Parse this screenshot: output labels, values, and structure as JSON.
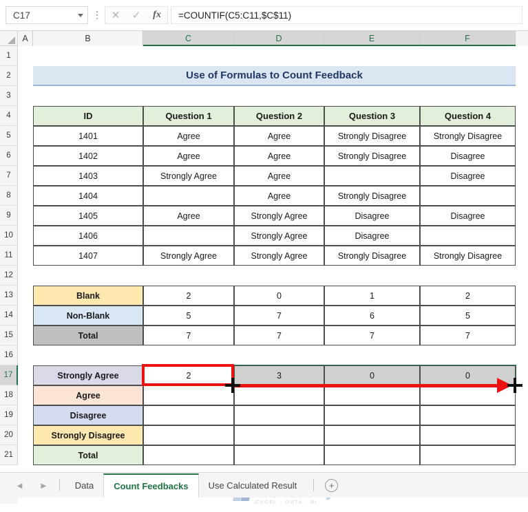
{
  "app": {
    "name_box_value": "C17",
    "formula_value": "=COUNTIF(C5:C11,$C$11)",
    "cancel_icon": "close-icon",
    "confirm_icon": "check-icon",
    "function_icon": "fx"
  },
  "columns": [
    {
      "label": "A",
      "selected": false
    },
    {
      "label": "B",
      "selected": false
    },
    {
      "label": "C",
      "selected": true
    },
    {
      "label": "D",
      "selected": true
    },
    {
      "label": "E",
      "selected": true
    },
    {
      "label": "F",
      "selected": true
    }
  ],
  "rows": [
    "1",
    "2",
    "3",
    "4",
    "5",
    "6",
    "7",
    "8",
    "9",
    "10",
    "11",
    "12",
    "13",
    "14",
    "15",
    "16",
    "17",
    "18",
    "19",
    "20",
    "21"
  ],
  "selected_row": "17",
  "title": "Use of Formulas to Count Feedback",
  "feedback_table": {
    "headers": [
      "ID",
      "Question 1",
      "Question 2",
      "Question 3",
      "Question 4"
    ],
    "rows": [
      [
        "1401",
        "Agree",
        "Agree",
        "Strongly Disagree",
        "Strongly Disagree"
      ],
      [
        "1402",
        "Agree",
        "Agree",
        "Strongly Disagree",
        "Disagree"
      ],
      [
        "1403",
        "Strongly Agree",
        "Agree",
        "",
        "Disagree"
      ],
      [
        "1404",
        "",
        "Agree",
        "Strongly Disagree",
        ""
      ],
      [
        "1405",
        "Agree",
        "Strongly Agree",
        "Disagree",
        "Disagree"
      ],
      [
        "1406",
        "",
        "Strongly Agree",
        "Disagree",
        ""
      ],
      [
        "1407",
        "Strongly Agree",
        "Strongly Agree",
        "Strongly Disagree",
        "Strongly Disagree"
      ]
    ]
  },
  "count_table": {
    "rows": [
      {
        "label": "Blank",
        "values": [
          "2",
          "0",
          "1",
          "2"
        ]
      },
      {
        "label": "Non-Blank",
        "values": [
          "5",
          "7",
          "6",
          "5"
        ]
      },
      {
        "label": "Total",
        "values": [
          "7",
          "7",
          "7",
          "7"
        ]
      }
    ]
  },
  "response_table": {
    "rows": [
      {
        "label": "Strongly Agree",
        "values": [
          "2",
          "3",
          "0",
          "0"
        ]
      },
      {
        "label": "Agree",
        "values": [
          "",
          "",
          "",
          ""
        ]
      },
      {
        "label": "Disagree",
        "values": [
          "",
          "",
          "",
          ""
        ]
      },
      {
        "label": "Strongly Disagree",
        "values": [
          "",
          "",
          "",
          ""
        ]
      },
      {
        "label": "Total",
        "values": [
          "",
          "",
          "",
          ""
        ]
      }
    ]
  },
  "watermark": {
    "main": "exceldemy",
    "sub": "EXCEL · DATA · BI"
  },
  "tabs": {
    "prev_icon": "◄",
    "next_icon": "►",
    "items": [
      {
        "label": "Data",
        "active": false
      },
      {
        "label": "Count Feedbacks",
        "active": true
      },
      {
        "label": "Use Calculated Result",
        "active": false
      }
    ],
    "add_label": "+"
  },
  "colors": {
    "accent_green": "#217346",
    "annotation_red": "#ee1111",
    "title_fill": "#dce6f2",
    "header_fill": "#e2efda"
  }
}
